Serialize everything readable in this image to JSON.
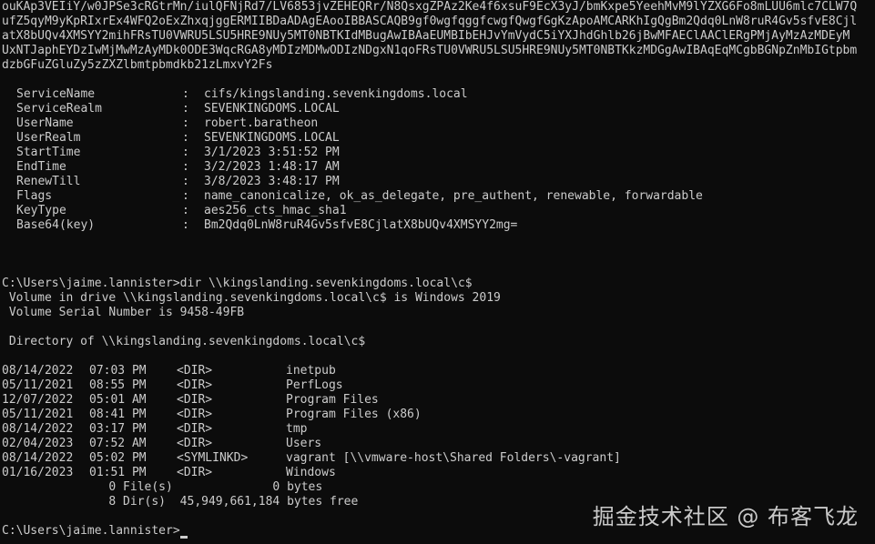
{
  "terminal": {
    "base64_lines": [
      "ouKAp3VEIiY/w0JPSe3cRGtrMn/iulQFNjRd7/LV6853jvZEHEQRr/N8QsxgZPAz2Ke4f6xsuF9EcX3yJ/bmKxpe5YeehMvM9lYZXG6Fo8mLUU6mlc7CLW7Q",
      "ufZ5qyM9yKpRIxrEx4WFQ2oExZhxqjggERMIIBDaADAgEAooIBBASCAQB9gf0wgfqggfcwgfQwgfGgKzApoAMCARKhIgQgBm2Qdq0LnW8ruR4Gv5sfvE8Cjl",
      "atX8bUQv4XMSYY2mihFRsTU0VWRU5LSU5HRE9NUy5MT0NBTKIdMBugAwIBAaEUMBIbEHJvYmVydC5iYXJhdGhlb26jBwMFAEClAAClERgPMjAyMzAzMDEyM",
      "UxNTJaphEYDzIwMjMwMzAyMDk0ODE3WqcRGA8yMDIzMDMwODIzNDgxN1qoFRsTU0VWRU5LSU5HRE9NUy5MT0NBTKkzMDGgAwIBAqEqMCgbBGNpZnMbIGtpbm",
      "dzbGFuZGluZy5zZXZlbmtpbmdkb21zLmxvY2Fs"
    ],
    "ticket": [
      {
        "key": "ServiceName",
        "value": "cifs/kingslanding.sevenkingdoms.local"
      },
      {
        "key": "ServiceRealm",
        "value": "SEVENKINGDOMS.LOCAL"
      },
      {
        "key": "UserName",
        "value": "robert.baratheon"
      },
      {
        "key": "UserRealm",
        "value": "SEVENKINGDOMS.LOCAL"
      },
      {
        "key": "StartTime",
        "value": "3/1/2023 3:51:52 PM"
      },
      {
        "key": "EndTime",
        "value": "3/2/2023 1:48:17 AM"
      },
      {
        "key": "RenewTill",
        "value": "3/8/2023 3:48:17 PM"
      },
      {
        "key": "Flags",
        "value": "name_canonicalize, ok_as_delegate, pre_authent, renewable, forwardable"
      },
      {
        "key": "KeyType",
        "value": "aes256_cts_hmac_sha1"
      },
      {
        "key": "Base64(key)",
        "value": "Bm2Qdq0LnW8ruR4Gv5sfvE8CjlatX8bUQv4XMSYY2mg="
      }
    ],
    "separator": ":",
    "command": "C:\\Users\\jaime.lannister>dir \\\\kingslanding.sevenkingdoms.local\\c$",
    "volume_line": " Volume in drive \\\\kingslanding.sevenkingdoms.local\\c$ is Windows 2019",
    "serial_line": " Volume Serial Number is 9458-49FB",
    "directory_line": " Directory of \\\\kingslanding.sevenkingdoms.local\\c$",
    "entries": [
      {
        "date": "08/14/2022",
        "time": "07:03 PM",
        "type": "<DIR>",
        "name": "inetpub"
      },
      {
        "date": "05/11/2021",
        "time": "08:55 PM",
        "type": "<DIR>",
        "name": "PerfLogs"
      },
      {
        "date": "12/07/2022",
        "time": "05:01 AM",
        "type": "<DIR>",
        "name": "Program Files"
      },
      {
        "date": "05/11/2021",
        "time": "08:41 PM",
        "type": "<DIR>",
        "name": "Program Files (x86)"
      },
      {
        "date": "08/14/2022",
        "time": "03:17 PM",
        "type": "<DIR>",
        "name": "tmp"
      },
      {
        "date": "02/04/2023",
        "time": "07:52 AM",
        "type": "<DIR>",
        "name": "Users"
      },
      {
        "date": "08/14/2022",
        "time": "05:02 PM",
        "type": "<SYMLINKD>",
        "name": "vagrant [\\\\vmware-host\\Shared Folders\\-vagrant]"
      },
      {
        "date": "01/16/2023",
        "time": "01:51 PM",
        "type": "<DIR>",
        "name": "Windows"
      }
    ],
    "files_summary": "               0 File(s)              0 bytes",
    "dirs_summary": "               8 Dir(s)  45,949,661,184 bytes free",
    "prompt": "C:\\Users\\jaime.lannister>"
  },
  "watermark": "掘金技术社区 @ 布客飞龙"
}
